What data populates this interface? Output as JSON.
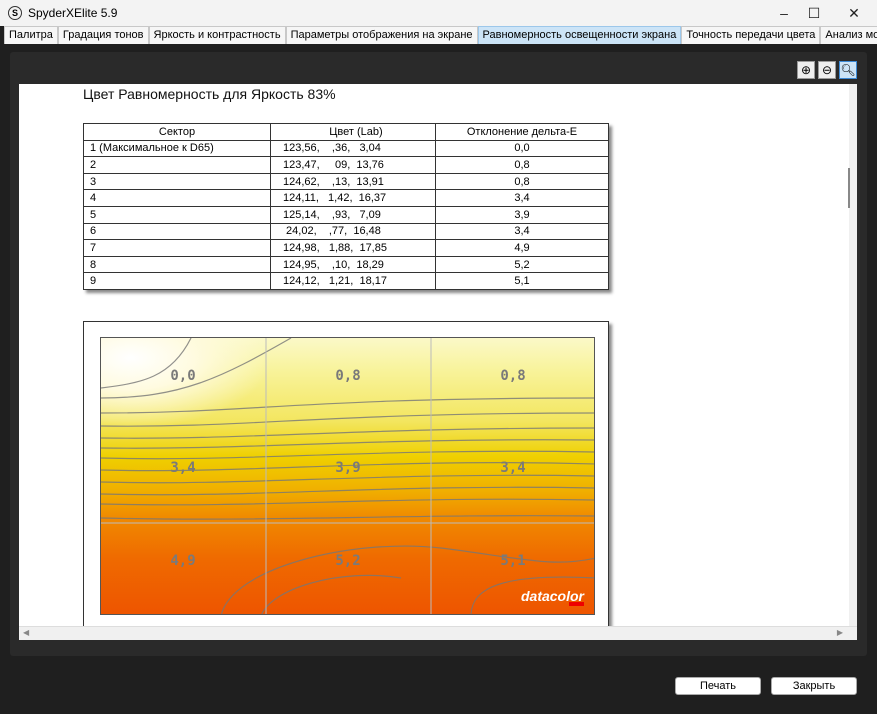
{
  "window": {
    "title": "SpyderXElite 5.9",
    "icon": "S"
  },
  "tabs": [
    "Палитра",
    "Градация тонов",
    "Яркость и контрастность",
    "Параметры отображения на экране",
    "Равномерность освещенности экрана",
    "Точность передачи цвета",
    "Анализ монитора"
  ],
  "active_tab": 4,
  "report": {
    "title": "Цвет Равномерность для Яркость 83%",
    "headers": [
      "Сектор",
      "Цвет (Lab)",
      "Отклонение дельта-E"
    ],
    "rows": [
      [
        "1 (Максимальное к D65)",
        "123,56,    ,36,   3,04",
        "0,0"
      ],
      [
        "2",
        "123,47,     09,  13,76",
        "0,8"
      ],
      [
        "3",
        "124,62,    ,13,  13,91",
        "0,8"
      ],
      [
        "4",
        "124,11,   1,42,  16,37",
        "3,4"
      ],
      [
        "5",
        "125,14,    ,93,   7,09",
        "3,9"
      ],
      [
        "6",
        " 24,02,    ,77,  16,48",
        "3,4"
      ],
      [
        "7",
        "124,98,   1,88,  17,85",
        "4,9"
      ],
      [
        "8",
        "124,95,    ,10,  18,29",
        "5,2"
      ],
      [
        "9",
        "124,12,   1,21,  18,17",
        "5,1"
      ]
    ],
    "map_labels": [
      "0,0",
      "0,8",
      "0,8",
      "3,4",
      "3,9",
      "3,4",
      "4,9",
      "5,2",
      "5,1"
    ],
    "logo": "datacolor"
  },
  "buttons": {
    "print": "Печать",
    "close": "Закрыть"
  }
}
